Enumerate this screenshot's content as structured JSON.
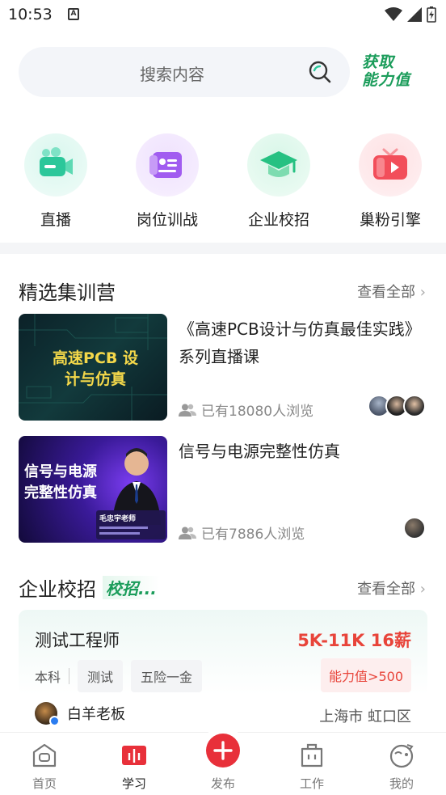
{
  "status_bar": {
    "time": "10:53",
    "notification_icon": "A"
  },
  "search": {
    "placeholder": "搜索内容"
  },
  "promo": {
    "line1": "获取",
    "line2": "能力值"
  },
  "quick_menu": [
    {
      "label": "直播",
      "icon": "live-camera-icon",
      "color": "#2cc79a"
    },
    {
      "label": "岗位训战",
      "icon": "resume-icon",
      "color": "#a15cf0"
    },
    {
      "label": "企业校招",
      "icon": "graduation-cap-icon",
      "color": "#26c182"
    },
    {
      "label": "巢粉引擎",
      "icon": "video-tv-icon",
      "color": "#f24e5a"
    }
  ],
  "camps": {
    "title": "精选集训营",
    "more": "查看全部",
    "items": [
      {
        "title": "《高速PCB设计与仿真最佳实践》系列直播课",
        "views": "已有18080人浏览",
        "thumb_text": "高速PCB 设计与仿真"
      },
      {
        "title": "信号与电源完整性仿真",
        "views": "已有7886人浏览",
        "thumb_text": "信号与电源 完整性仿真",
        "thumb_caption": "毛忠宇老师"
      }
    ]
  },
  "campus": {
    "title": "企业校招",
    "badge": "校招...",
    "more": "查看全部",
    "job": {
      "title": "测试工程师",
      "salary": "5K-11K 16薪",
      "education": "本科",
      "tags": [
        "测试",
        "五险一金"
      ],
      "ability": "能力值>500",
      "boss": "白羊老板",
      "location": "上海市 虹口区"
    }
  },
  "bottom_nav": [
    {
      "label": "首页",
      "icon": "home-icon"
    },
    {
      "label": "学习",
      "icon": "book-icon",
      "active": true
    },
    {
      "label": "发布",
      "icon": "plus-icon"
    },
    {
      "label": "工作",
      "icon": "briefcase-icon"
    },
    {
      "label": "我的",
      "icon": "profile-icon"
    }
  ]
}
